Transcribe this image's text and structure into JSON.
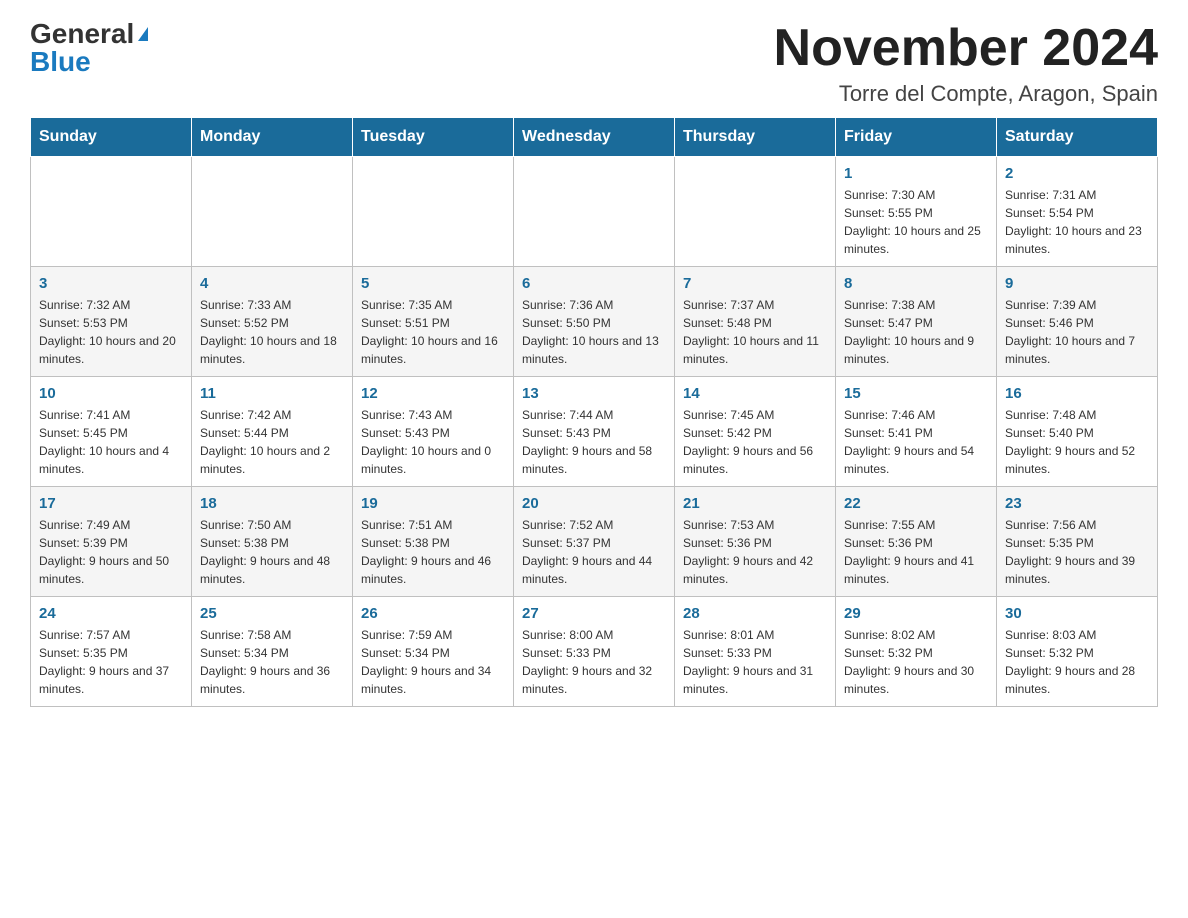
{
  "header": {
    "logo_general": "General",
    "logo_blue": "Blue",
    "title": "November 2024",
    "subtitle": "Torre del Compte, Aragon, Spain"
  },
  "weekdays": [
    "Sunday",
    "Monday",
    "Tuesday",
    "Wednesday",
    "Thursday",
    "Friday",
    "Saturday"
  ],
  "rows": [
    [
      {
        "day": "",
        "info": ""
      },
      {
        "day": "",
        "info": ""
      },
      {
        "day": "",
        "info": ""
      },
      {
        "day": "",
        "info": ""
      },
      {
        "day": "",
        "info": ""
      },
      {
        "day": "1",
        "info": "Sunrise: 7:30 AM\nSunset: 5:55 PM\nDaylight: 10 hours and 25 minutes."
      },
      {
        "day": "2",
        "info": "Sunrise: 7:31 AM\nSunset: 5:54 PM\nDaylight: 10 hours and 23 minutes."
      }
    ],
    [
      {
        "day": "3",
        "info": "Sunrise: 7:32 AM\nSunset: 5:53 PM\nDaylight: 10 hours and 20 minutes."
      },
      {
        "day": "4",
        "info": "Sunrise: 7:33 AM\nSunset: 5:52 PM\nDaylight: 10 hours and 18 minutes."
      },
      {
        "day": "5",
        "info": "Sunrise: 7:35 AM\nSunset: 5:51 PM\nDaylight: 10 hours and 16 minutes."
      },
      {
        "day": "6",
        "info": "Sunrise: 7:36 AM\nSunset: 5:50 PM\nDaylight: 10 hours and 13 minutes."
      },
      {
        "day": "7",
        "info": "Sunrise: 7:37 AM\nSunset: 5:48 PM\nDaylight: 10 hours and 11 minutes."
      },
      {
        "day": "8",
        "info": "Sunrise: 7:38 AM\nSunset: 5:47 PM\nDaylight: 10 hours and 9 minutes."
      },
      {
        "day": "9",
        "info": "Sunrise: 7:39 AM\nSunset: 5:46 PM\nDaylight: 10 hours and 7 minutes."
      }
    ],
    [
      {
        "day": "10",
        "info": "Sunrise: 7:41 AM\nSunset: 5:45 PM\nDaylight: 10 hours and 4 minutes."
      },
      {
        "day": "11",
        "info": "Sunrise: 7:42 AM\nSunset: 5:44 PM\nDaylight: 10 hours and 2 minutes."
      },
      {
        "day": "12",
        "info": "Sunrise: 7:43 AM\nSunset: 5:43 PM\nDaylight: 10 hours and 0 minutes."
      },
      {
        "day": "13",
        "info": "Sunrise: 7:44 AM\nSunset: 5:43 PM\nDaylight: 9 hours and 58 minutes."
      },
      {
        "day": "14",
        "info": "Sunrise: 7:45 AM\nSunset: 5:42 PM\nDaylight: 9 hours and 56 minutes."
      },
      {
        "day": "15",
        "info": "Sunrise: 7:46 AM\nSunset: 5:41 PM\nDaylight: 9 hours and 54 minutes."
      },
      {
        "day": "16",
        "info": "Sunrise: 7:48 AM\nSunset: 5:40 PM\nDaylight: 9 hours and 52 minutes."
      }
    ],
    [
      {
        "day": "17",
        "info": "Sunrise: 7:49 AM\nSunset: 5:39 PM\nDaylight: 9 hours and 50 minutes."
      },
      {
        "day": "18",
        "info": "Sunrise: 7:50 AM\nSunset: 5:38 PM\nDaylight: 9 hours and 48 minutes."
      },
      {
        "day": "19",
        "info": "Sunrise: 7:51 AM\nSunset: 5:38 PM\nDaylight: 9 hours and 46 minutes."
      },
      {
        "day": "20",
        "info": "Sunrise: 7:52 AM\nSunset: 5:37 PM\nDaylight: 9 hours and 44 minutes."
      },
      {
        "day": "21",
        "info": "Sunrise: 7:53 AM\nSunset: 5:36 PM\nDaylight: 9 hours and 42 minutes."
      },
      {
        "day": "22",
        "info": "Sunrise: 7:55 AM\nSunset: 5:36 PM\nDaylight: 9 hours and 41 minutes."
      },
      {
        "day": "23",
        "info": "Sunrise: 7:56 AM\nSunset: 5:35 PM\nDaylight: 9 hours and 39 minutes."
      }
    ],
    [
      {
        "day": "24",
        "info": "Sunrise: 7:57 AM\nSunset: 5:35 PM\nDaylight: 9 hours and 37 minutes."
      },
      {
        "day": "25",
        "info": "Sunrise: 7:58 AM\nSunset: 5:34 PM\nDaylight: 9 hours and 36 minutes."
      },
      {
        "day": "26",
        "info": "Sunrise: 7:59 AM\nSunset: 5:34 PM\nDaylight: 9 hours and 34 minutes."
      },
      {
        "day": "27",
        "info": "Sunrise: 8:00 AM\nSunset: 5:33 PM\nDaylight: 9 hours and 32 minutes."
      },
      {
        "day": "28",
        "info": "Sunrise: 8:01 AM\nSunset: 5:33 PM\nDaylight: 9 hours and 31 minutes."
      },
      {
        "day": "29",
        "info": "Sunrise: 8:02 AM\nSunset: 5:32 PM\nDaylight: 9 hours and 30 minutes."
      },
      {
        "day": "30",
        "info": "Sunrise: 8:03 AM\nSunset: 5:32 PM\nDaylight: 9 hours and 28 minutes."
      }
    ]
  ]
}
